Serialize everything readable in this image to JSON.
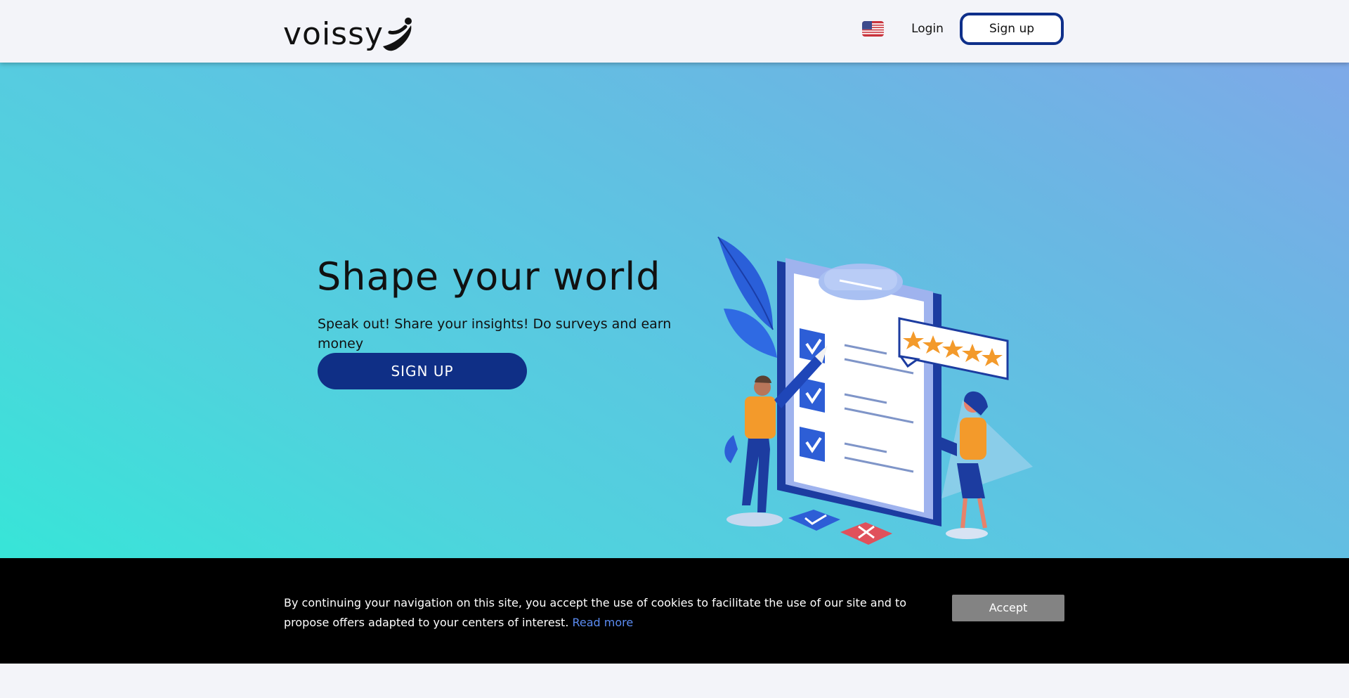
{
  "header": {
    "logo_text": "voissy",
    "language_icon": "us-flag-icon",
    "login_label": "Login",
    "signup_label": "Sign up"
  },
  "hero": {
    "title": "Shape your world",
    "subtitle": "Speak out! Share your insights! Do surveys and earn money",
    "cta_label": "SIGN UP",
    "illustration": "survey-clipboard-illustration",
    "rating_stars": 5
  },
  "cookie_banner": {
    "text": "By continuing your navigation on this site, you accept the use of cookies to facilitate the use of our site and to propose offers adapted to your centers of interest.",
    "link_label": "Read more",
    "accept_label": "Accept"
  },
  "colors": {
    "brand_navy": "#0f2f86",
    "hero_gradient_start": "#37e5d8",
    "hero_gradient_end": "#7ea9e8",
    "cookie_bg": "#000000",
    "link_blue": "#5b8cf2",
    "accept_gray": "#838383"
  }
}
